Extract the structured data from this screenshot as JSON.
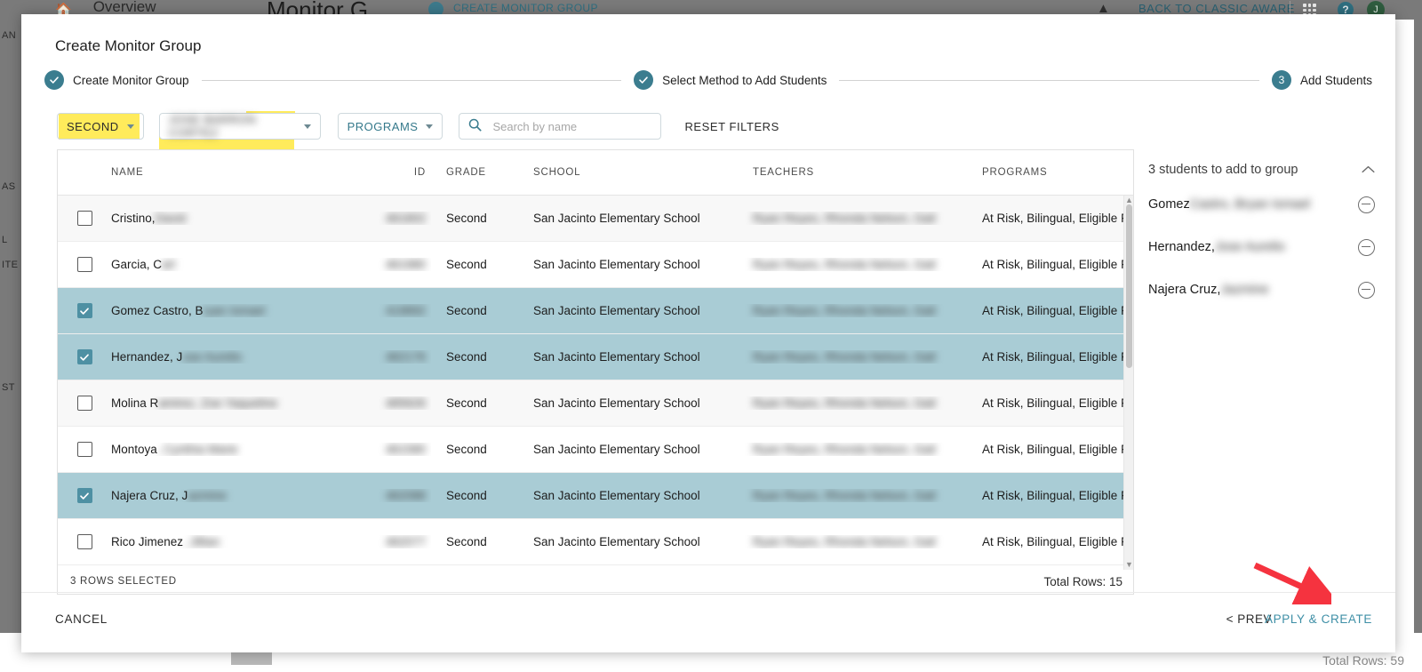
{
  "background": {
    "home_icon": "home-icon",
    "overview_label": "Overview",
    "monitor_title": "Monitor G",
    "create_monitor_group_label": "CREATE MONITOR GROUP",
    "back_to_classic_label": "BACK TO CLASSIC AWARE",
    "grid_icon": "app-grid-icon",
    "help_icon": "help-icon",
    "avatar_initial": "J",
    "chevron_icon": "chevron-up-icon",
    "rail_fragments": [
      "AN",
      "AS",
      "L",
      "ITE",
      "ST"
    ],
    "total_rows_partial": "Total Rows: 59"
  },
  "modal": {
    "title": "Create Monitor Group",
    "stepper": [
      {
        "label": "Create Monitor Group",
        "state": "complete",
        "badge": "check"
      },
      {
        "label": "Select Method to Add Students",
        "state": "complete",
        "badge": "check"
      },
      {
        "label": "Add Students",
        "state": "active",
        "badge": "3"
      }
    ],
    "filters": {
      "grade": "SECOND",
      "teacher": "JOSE BARRON CORTEZ",
      "teacher_visible_tail": "Z",
      "programs": "PROGRAMS",
      "search_placeholder": "Search by name",
      "search_value": "",
      "reset_filters": "RESET FILTERS",
      "highlight_color": "#ffe94d"
    },
    "table": {
      "columns": [
        "NAME",
        "ID",
        "GRADE",
        "SCHOOL",
        "TEACHERS",
        "PROGRAMS"
      ],
      "rows": [
        {
          "name_visible": "Cristino,",
          "name_redacted": "David",
          "id": "461802",
          "grade": "Second",
          "school": "San Jacinto Elementary School",
          "teachers": "Ryan Reyes, Rhonda Nelson, Gail",
          "programs": "At Risk, Bilingual, Eligible For Fr...",
          "selected": false
        },
        {
          "name_visible": "Garcia, C",
          "name_redacted": "arl",
          "id": "461980",
          "grade": "Second",
          "school": "San Jacinto Elementary School",
          "teachers": "Ryan Reyes, Rhonda Nelson, Gail",
          "programs": "At Risk, Bilingual, Eligible For Fr...",
          "selected": false
        },
        {
          "name_visible": "Gomez Castro, B",
          "name_redacted": "ryan Ismael",
          "id": "419892",
          "grade": "Second",
          "school": "San Jacinto Elementary School",
          "teachers": "Ryan Reyes, Rhonda Nelson, Gail",
          "programs": "At Risk, Bilingual, Eligible For Fr...",
          "selected": true
        },
        {
          "name_visible": "Hernandez, J",
          "name_redacted": "ose Aurelio",
          "id": "462176",
          "grade": "Second",
          "school": "San Jacinto Elementary School",
          "teachers": "Ryan Reyes, Rhonda Nelson, Gail",
          "programs": "At Risk, Bilingual, Eligible For Fr...",
          "selected": true
        },
        {
          "name_visible": "Molina R",
          "name_redacted": "amirez, Zoe Yaqueline",
          "id": "485626",
          "grade": "Second",
          "school": "San Jacinto Elementary School",
          "teachers": "Ryan Reyes, Rhonda Nelson, Gail",
          "programs": "At Risk, Bilingual, Eligible For Fr...",
          "selected": false
        },
        {
          "name_visible": "Montoya",
          "name_redacted": ", Cynthia Marie",
          "id": "461580",
          "grade": "Second",
          "school": "San Jacinto Elementary School",
          "teachers": "Ryan Reyes, Rhonda Nelson, Gail",
          "programs": "At Risk, Bilingual, Eligible For Fr...",
          "selected": false
        },
        {
          "name_visible": "Najera Cruz, J",
          "name_redacted": "azmine",
          "id": "462088",
          "grade": "Second",
          "school": "San Jacinto Elementary School",
          "teachers": "Ryan Reyes, Rhonda Nelson, Gail",
          "programs": "At Risk, Bilingual, Eligible For Fr...",
          "selected": true
        },
        {
          "name_visible": "Rico Jimenez",
          "name_redacted": ", Jillian",
          "id": "462077",
          "grade": "Second",
          "school": "San Jacinto Elementary School",
          "teachers": "Ryan Reyes, Rhonda Nelson, Gail",
          "programs": "At Risk, Bilingual, Eligible For Fr...",
          "selected": false
        }
      ],
      "rows_selected_label": "3 ROWS SELECTED",
      "total_rows_label": "Total Rows: 15"
    },
    "side_panel": {
      "heading": "3 students to add to group",
      "collapse_icon": "chevron-up-icon",
      "students": [
        {
          "name_visible": "Gomez",
          "name_redacted": " Castro, Bryan Ismael"
        },
        {
          "name_visible": "Hernandez,",
          "name_redacted": " Jose Aurelio"
        },
        {
          "name_visible": "Najera Cruz,",
          "name_redacted": " Jazmine"
        }
      ]
    },
    "footer": {
      "cancel": "CANCEL",
      "prev": "< PREV",
      "apply": "APPLY & CREATE"
    }
  },
  "annotation": {
    "arrow_color": "#f5333f",
    "arrow_target": "apply-and-create-button"
  },
  "colors": {
    "accent_teal": "#3b7d8f",
    "selected_row": "#a9ccd5",
    "checkbox_on": "#4e90a3",
    "link_teal": "#3e8fa6",
    "highlight_yellow": "#ffe94d"
  }
}
